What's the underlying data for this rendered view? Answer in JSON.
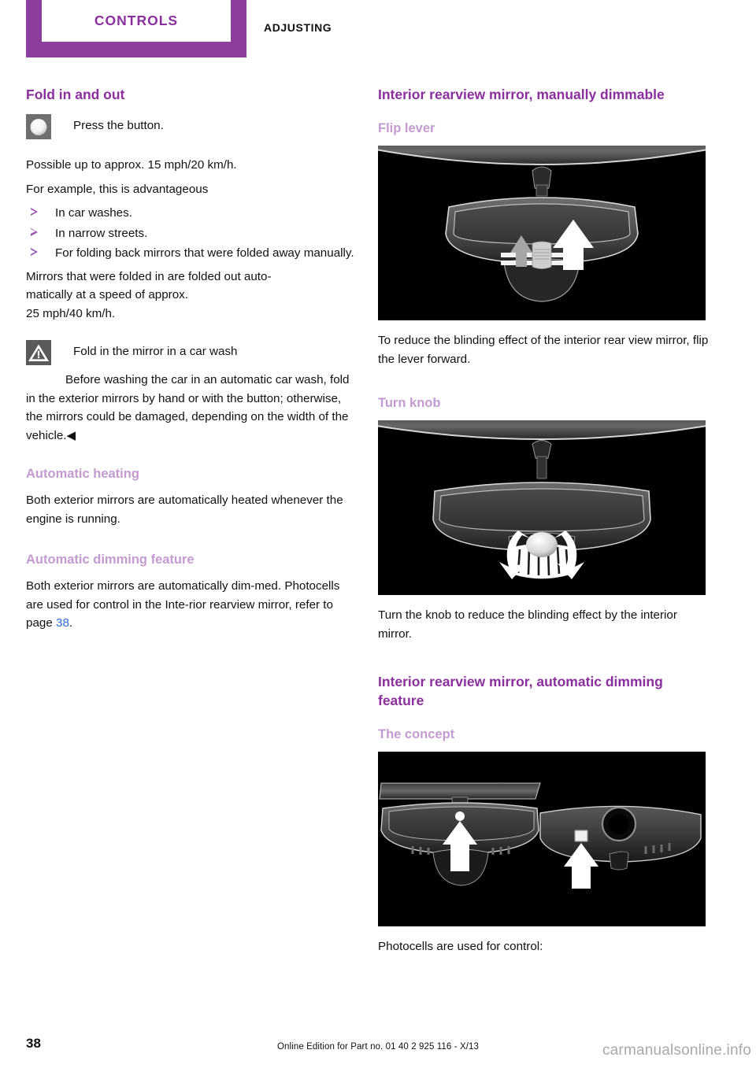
{
  "header": {
    "tab_label": "CONTROLS",
    "section_label": "ADJUSTING",
    "tab_color": "#8B3E9E",
    "tab_text_color": "#8B2E9E"
  },
  "left_column": {
    "heading": "Fold in and out",
    "button_note": "Press the button.",
    "button_icon": "round-button-icon",
    "paragraph_1": "Possible up to approx. 15 mph/20 km/h.",
    "paragraph_2": "For example, this is advantageous",
    "bullets": [
      "In car washes.",
      "In narrow streets.",
      "For folding back mirrors that were folded away manually."
    ],
    "paragraph_3": "Mirrors that were folded in are folded out auto-",
    "paragraph_3b": "matically at a speed of approx.",
    "paragraph_3c": "25 mph/40 km/h.",
    "warning": {
      "icon": "warning-triangle-icon",
      "title": "Fold in the mirror in a car wash",
      "body": "Before washing the car in an automatic car wash, fold in the exterior mirrors by hand or with the button; otherwise, the mirrors could be damaged, depending on the width of the vehicle.",
      "end_mark": "◀"
    },
    "heating": {
      "heading": "Automatic heating",
      "body": "Both exterior mirrors are automatically heated whenever the engine is running."
    },
    "dimming": {
      "heading": "Automatic dimming feature",
      "body_before": "Both exterior mirrors are automatically dim‑med. Photocells are used for control in the Inte‑rior rearview mirror, refer to page ",
      "page_ref": "38",
      "body_after": "."
    }
  },
  "right_column": {
    "heading_manual": "Interior rearview mirror, manually dimmable",
    "flip_lever": {
      "heading": "Flip lever",
      "figure_name": "rearview-mirror-flip-lever-figure",
      "caption": "To reduce the blinding effect of the interior rear view mirror, flip the lever forward."
    },
    "turn_knob": {
      "heading": "Turn knob",
      "figure_name": "rearview-mirror-turn-knob-figure",
      "caption": "Turn the knob to reduce the blinding effect by the interior mirror."
    },
    "heading_auto": "Interior rearview mirror, automatic dimming feature",
    "concept": {
      "heading": "The concept",
      "figure_name": "rearview-mirror-photocells-figure",
      "caption": "Photocells are used for control:"
    }
  },
  "footer": {
    "page_number": "38",
    "edition": "Online Edition for Part no. 01 40 2 925 116 - X/13",
    "watermark": "carmanualsonline.info"
  }
}
